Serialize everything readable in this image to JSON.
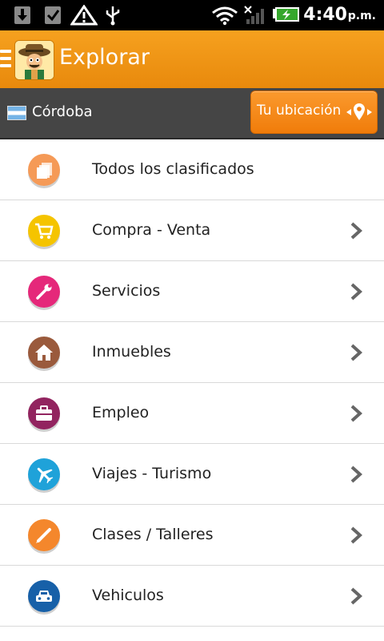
{
  "status_bar": {
    "time": "4:40",
    "ampm": "p.m."
  },
  "app_bar": {
    "title": "Explorar"
  },
  "location": {
    "city": "Córdoba",
    "button_label": "Tu ubicación"
  },
  "categories": [
    {
      "label": "Todos los clasificados",
      "icon": "stack-icon",
      "color": "#f59a57",
      "chevron": false
    },
    {
      "label": "Compra - Venta",
      "icon": "cart-icon",
      "color": "#f5c400",
      "chevron": true
    },
    {
      "label": "Servicios",
      "icon": "wrench-icon",
      "color": "#e5287a",
      "chevron": true
    },
    {
      "label": "Inmuebles",
      "icon": "house-icon",
      "color": "#9a5a3c",
      "chevron": true
    },
    {
      "label": "Empleo",
      "icon": "briefcase-icon",
      "color": "#92245f",
      "chevron": true
    },
    {
      "label": "Viajes - Turismo",
      "icon": "airplane-icon",
      "color": "#1fa2d9",
      "chevron": true
    },
    {
      "label": "Clases / Talleres",
      "icon": "pencil-icon",
      "color": "#f4872c",
      "chevron": true
    },
    {
      "label": "Vehiculos",
      "icon": "car-icon",
      "color": "#1760a8",
      "chevron": true
    }
  ]
}
